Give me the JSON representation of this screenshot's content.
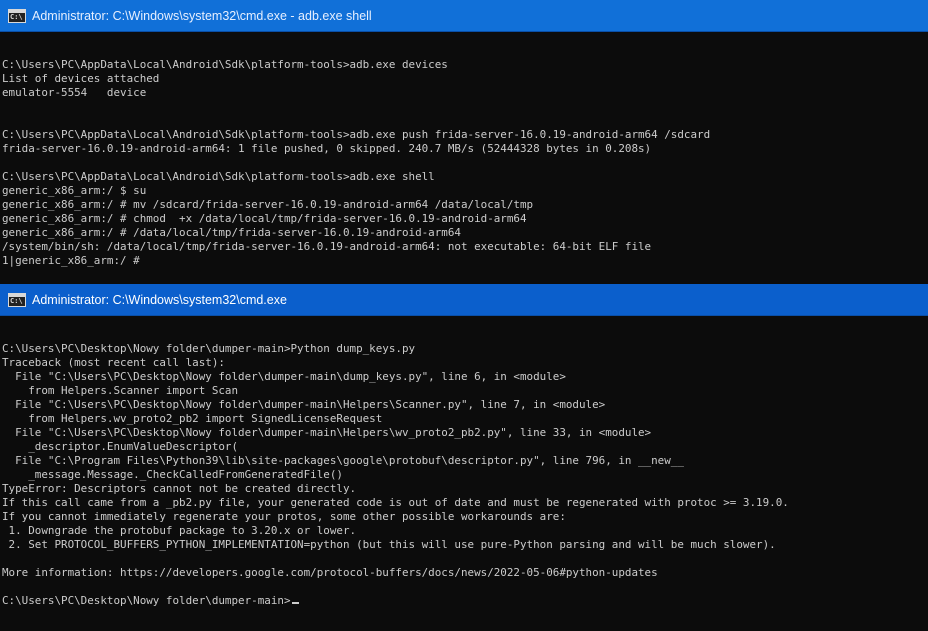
{
  "windows": [
    {
      "title": "Administrator: C:\\Windows\\system32\\cmd.exe - adb.exe  shell",
      "icon": "cmd-icon",
      "lines": [
        "",
        "C:\\Users\\PC\\AppData\\Local\\Android\\Sdk\\platform-tools>adb.exe devices",
        "List of devices attached",
        "emulator-5554   device",
        "",
        "",
        "C:\\Users\\PC\\AppData\\Local\\Android\\Sdk\\platform-tools>adb.exe push frida-server-16.0.19-android-arm64 /sdcard",
        "frida-server-16.0.19-android-arm64: 1 file pushed, 0 skipped. 240.7 MB/s (52444328 bytes in 0.208s)",
        "",
        "C:\\Users\\PC\\AppData\\Local\\Android\\Sdk\\platform-tools>adb.exe shell",
        "generic_x86_arm:/ $ su",
        "generic_x86_arm:/ # mv /sdcard/frida-server-16.0.19-android-arm64 /data/local/tmp",
        "generic_x86_arm:/ # chmod  +x /data/local/tmp/frida-server-16.0.19-android-arm64",
        "generic_x86_arm:/ # /data/local/tmp/frida-server-16.0.19-android-arm64",
        "/system/bin/sh: /data/local/tmp/frida-server-16.0.19-android-arm64: not executable: 64-bit ELF file",
        "1|generic_x86_arm:/ #"
      ]
    },
    {
      "title": "Administrator: C:\\Windows\\system32\\cmd.exe",
      "icon": "cmd-icon",
      "lines": [
        "",
        "C:\\Users\\PC\\Desktop\\Nowy folder\\dumper-main>Python dump_keys.py",
        "Traceback (most recent call last):",
        "  File \"C:\\Users\\PC\\Desktop\\Nowy folder\\dumper-main\\dump_keys.py\", line 6, in <module>",
        "    from Helpers.Scanner import Scan",
        "  File \"C:\\Users\\PC\\Desktop\\Nowy folder\\dumper-main\\Helpers\\Scanner.py\", line 7, in <module>",
        "    from Helpers.wv_proto2_pb2 import SignedLicenseRequest",
        "  File \"C:\\Users\\PC\\Desktop\\Nowy folder\\dumper-main\\Helpers\\wv_proto2_pb2.py\", line 33, in <module>",
        "    _descriptor.EnumValueDescriptor(",
        "  File \"C:\\Program Files\\Python39\\lib\\site-packages\\google\\protobuf\\descriptor.py\", line 796, in __new__",
        "    _message.Message._CheckCalledFromGeneratedFile()",
        "TypeError: Descriptors cannot not be created directly.",
        "If this call came from a _pb2.py file, your generated code is out of date and must be regenerated with protoc >= 3.19.0.",
        "If you cannot immediately regenerate your protos, some other possible workarounds are:",
        " 1. Downgrade the protobuf package to 3.20.x or lower.",
        " 2. Set PROTOCOL_BUFFERS_PYTHON_IMPLEMENTATION=python (but this will use pure-Python parsing and will be much slower).",
        "",
        "More information: https://developers.google.com/protocol-buffers/docs/news/2022-05-06#python-updates",
        "",
        "C:\\Users\\PC\\Desktop\\Nowy folder\\dumper-main>"
      ]
    }
  ]
}
